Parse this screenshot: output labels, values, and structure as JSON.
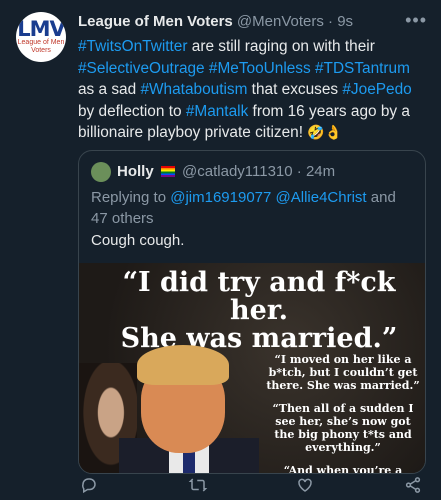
{
  "author": {
    "name": "League of Men Voters",
    "handle": "@MenVoters",
    "time": "9s",
    "avatar_text": "LMV",
    "avatar_subtext": "League of Men Voters"
  },
  "tweet": {
    "segments": [
      {
        "text": "#TwitsOnTwitter",
        "tag": true
      },
      {
        "text": " are still raging on with their ",
        "tag": false
      },
      {
        "text": "#SelectiveOutrage",
        "tag": true
      },
      {
        "text": " ",
        "tag": false
      },
      {
        "text": "#MeTooUnless",
        "tag": true
      },
      {
        "text": " ",
        "tag": false
      },
      {
        "text": "#TDSTantrum",
        "tag": true
      },
      {
        "text": " as a sad ",
        "tag": false
      },
      {
        "text": "#Whataboutism",
        "tag": true
      },
      {
        "text": " that excuses ",
        "tag": false
      },
      {
        "text": "#JoePedo",
        "tag": true
      },
      {
        "text": " by deflection to ",
        "tag": false
      },
      {
        "text": "#Mantalk",
        "tag": true
      },
      {
        "text": " from 16 years ago by a billionaire playboy private citizen! ",
        "tag": false
      }
    ],
    "emojis": "🤣👌"
  },
  "quoted": {
    "name": "Holly",
    "handle": "@catlady111310",
    "time": "24m",
    "replying_prefix": "Replying to ",
    "replying_users": "@jim16919077 @Allie4Christ",
    "replying_suffix": " and 47 others",
    "text": "Cough cough.",
    "media": {
      "headline_line1": "“I did try and f*ck her.",
      "headline_line2": "She was married.”",
      "quote1": "“I moved on her like a b*tch, but I couldn’t get there. She was married.”",
      "quote2": "“Then all of a sudden I see her, she’s now got the big phony t*ts and everything.”",
      "quote3": "“And when you’re a"
    }
  },
  "actions": {
    "reply_icon": "reply-icon",
    "retweet_icon": "retweet-icon",
    "like_icon": "heart-icon",
    "share_icon": "share-icon"
  },
  "colors": {
    "background": "#15202b",
    "link": "#1d9bf0",
    "secondary": "#8b98a5"
  }
}
